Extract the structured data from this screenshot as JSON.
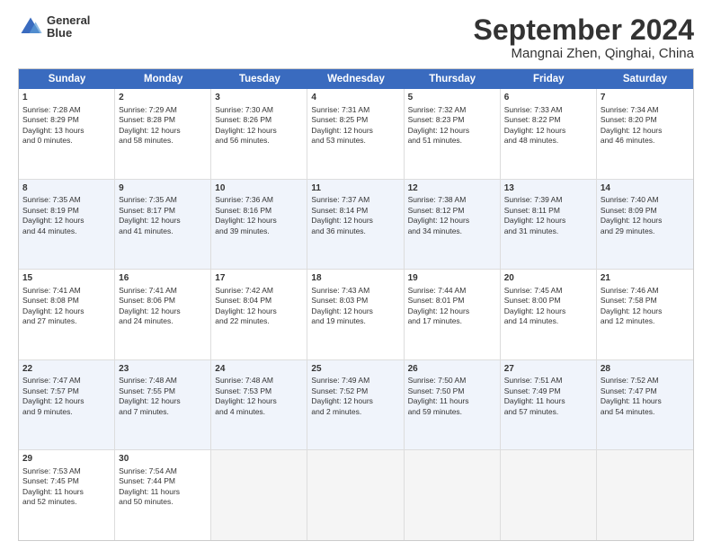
{
  "logo": {
    "line1": "General",
    "line2": "Blue"
  },
  "title": "September 2024",
  "subtitle": "Mangnai Zhen, Qinghai, China",
  "weekdays": [
    "Sunday",
    "Monday",
    "Tuesday",
    "Wednesday",
    "Thursday",
    "Friday",
    "Saturday"
  ],
  "rows": [
    [
      {
        "day": "1",
        "lines": [
          "Sunrise: 7:28 AM",
          "Sunset: 8:29 PM",
          "Daylight: 13 hours",
          "and 0 minutes."
        ]
      },
      {
        "day": "2",
        "lines": [
          "Sunrise: 7:29 AM",
          "Sunset: 8:28 PM",
          "Daylight: 12 hours",
          "and 58 minutes."
        ]
      },
      {
        "day": "3",
        "lines": [
          "Sunrise: 7:30 AM",
          "Sunset: 8:26 PM",
          "Daylight: 12 hours",
          "and 56 minutes."
        ]
      },
      {
        "day": "4",
        "lines": [
          "Sunrise: 7:31 AM",
          "Sunset: 8:25 PM",
          "Daylight: 12 hours",
          "and 53 minutes."
        ]
      },
      {
        "day": "5",
        "lines": [
          "Sunrise: 7:32 AM",
          "Sunset: 8:23 PM",
          "Daylight: 12 hours",
          "and 51 minutes."
        ]
      },
      {
        "day": "6",
        "lines": [
          "Sunrise: 7:33 AM",
          "Sunset: 8:22 PM",
          "Daylight: 12 hours",
          "and 48 minutes."
        ]
      },
      {
        "day": "7",
        "lines": [
          "Sunrise: 7:34 AM",
          "Sunset: 8:20 PM",
          "Daylight: 12 hours",
          "and 46 minutes."
        ]
      }
    ],
    [
      {
        "day": "8",
        "lines": [
          "Sunrise: 7:35 AM",
          "Sunset: 8:19 PM",
          "Daylight: 12 hours",
          "and 44 minutes."
        ]
      },
      {
        "day": "9",
        "lines": [
          "Sunrise: 7:35 AM",
          "Sunset: 8:17 PM",
          "Daylight: 12 hours",
          "and 41 minutes."
        ]
      },
      {
        "day": "10",
        "lines": [
          "Sunrise: 7:36 AM",
          "Sunset: 8:16 PM",
          "Daylight: 12 hours",
          "and 39 minutes."
        ]
      },
      {
        "day": "11",
        "lines": [
          "Sunrise: 7:37 AM",
          "Sunset: 8:14 PM",
          "Daylight: 12 hours",
          "and 36 minutes."
        ]
      },
      {
        "day": "12",
        "lines": [
          "Sunrise: 7:38 AM",
          "Sunset: 8:12 PM",
          "Daylight: 12 hours",
          "and 34 minutes."
        ]
      },
      {
        "day": "13",
        "lines": [
          "Sunrise: 7:39 AM",
          "Sunset: 8:11 PM",
          "Daylight: 12 hours",
          "and 31 minutes."
        ]
      },
      {
        "day": "14",
        "lines": [
          "Sunrise: 7:40 AM",
          "Sunset: 8:09 PM",
          "Daylight: 12 hours",
          "and 29 minutes."
        ]
      }
    ],
    [
      {
        "day": "15",
        "lines": [
          "Sunrise: 7:41 AM",
          "Sunset: 8:08 PM",
          "Daylight: 12 hours",
          "and 27 minutes."
        ]
      },
      {
        "day": "16",
        "lines": [
          "Sunrise: 7:41 AM",
          "Sunset: 8:06 PM",
          "Daylight: 12 hours",
          "and 24 minutes."
        ]
      },
      {
        "day": "17",
        "lines": [
          "Sunrise: 7:42 AM",
          "Sunset: 8:04 PM",
          "Daylight: 12 hours",
          "and 22 minutes."
        ]
      },
      {
        "day": "18",
        "lines": [
          "Sunrise: 7:43 AM",
          "Sunset: 8:03 PM",
          "Daylight: 12 hours",
          "and 19 minutes."
        ]
      },
      {
        "day": "19",
        "lines": [
          "Sunrise: 7:44 AM",
          "Sunset: 8:01 PM",
          "Daylight: 12 hours",
          "and 17 minutes."
        ]
      },
      {
        "day": "20",
        "lines": [
          "Sunrise: 7:45 AM",
          "Sunset: 8:00 PM",
          "Daylight: 12 hours",
          "and 14 minutes."
        ]
      },
      {
        "day": "21",
        "lines": [
          "Sunrise: 7:46 AM",
          "Sunset: 7:58 PM",
          "Daylight: 12 hours",
          "and 12 minutes."
        ]
      }
    ],
    [
      {
        "day": "22",
        "lines": [
          "Sunrise: 7:47 AM",
          "Sunset: 7:57 PM",
          "Daylight: 12 hours",
          "and 9 minutes."
        ]
      },
      {
        "day": "23",
        "lines": [
          "Sunrise: 7:48 AM",
          "Sunset: 7:55 PM",
          "Daylight: 12 hours",
          "and 7 minutes."
        ]
      },
      {
        "day": "24",
        "lines": [
          "Sunrise: 7:48 AM",
          "Sunset: 7:53 PM",
          "Daylight: 12 hours",
          "and 4 minutes."
        ]
      },
      {
        "day": "25",
        "lines": [
          "Sunrise: 7:49 AM",
          "Sunset: 7:52 PM",
          "Daylight: 12 hours",
          "and 2 minutes."
        ]
      },
      {
        "day": "26",
        "lines": [
          "Sunrise: 7:50 AM",
          "Sunset: 7:50 PM",
          "Daylight: 11 hours",
          "and 59 minutes."
        ]
      },
      {
        "day": "27",
        "lines": [
          "Sunrise: 7:51 AM",
          "Sunset: 7:49 PM",
          "Daylight: 11 hours",
          "and 57 minutes."
        ]
      },
      {
        "day": "28",
        "lines": [
          "Sunrise: 7:52 AM",
          "Sunset: 7:47 PM",
          "Daylight: 11 hours",
          "and 54 minutes."
        ]
      }
    ],
    [
      {
        "day": "29",
        "lines": [
          "Sunrise: 7:53 AM",
          "Sunset: 7:45 PM",
          "Daylight: 11 hours",
          "and 52 minutes."
        ]
      },
      {
        "day": "30",
        "lines": [
          "Sunrise: 7:54 AM",
          "Sunset: 7:44 PM",
          "Daylight: 11 hours",
          "and 50 minutes."
        ]
      },
      {
        "day": "",
        "lines": [],
        "empty": true
      },
      {
        "day": "",
        "lines": [],
        "empty": true
      },
      {
        "day": "",
        "lines": [],
        "empty": true
      },
      {
        "day": "",
        "lines": [],
        "empty": true
      },
      {
        "day": "",
        "lines": [],
        "empty": true
      }
    ]
  ]
}
